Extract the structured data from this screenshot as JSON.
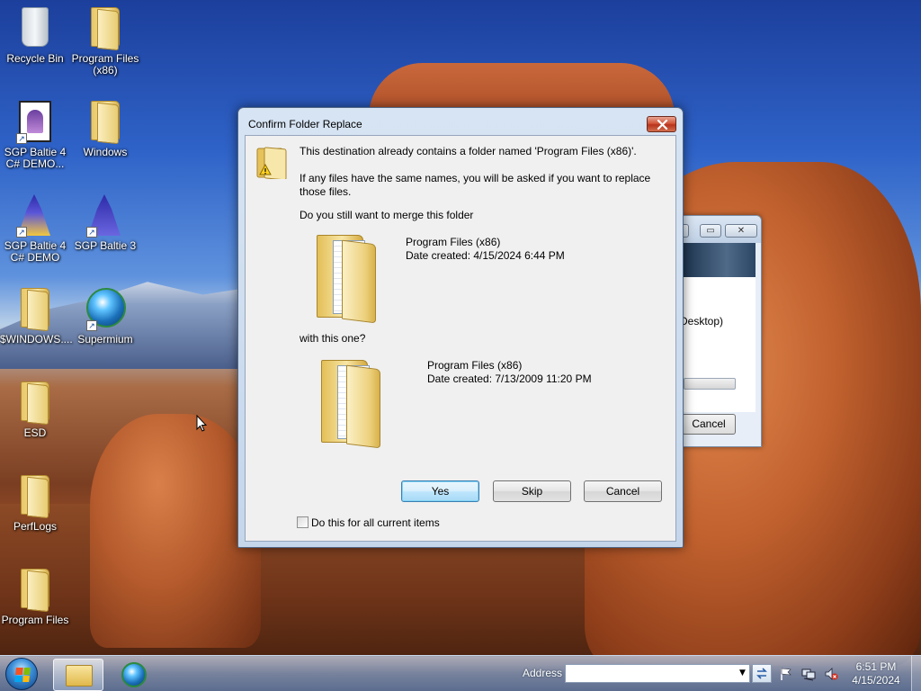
{
  "desktop": {
    "icons": [
      {
        "label": "Recycle Bin"
      },
      {
        "label": "Program Files (x86)"
      },
      {
        "label": "SGP Baltie 4 C# DEMO..."
      },
      {
        "label": "Windows"
      },
      {
        "label": "SGP Baltie 4 C# DEMO"
      },
      {
        "label": "SGP Baltie 3"
      },
      {
        "label": "$WINDOWS...."
      },
      {
        "label": "Supermium"
      },
      {
        "label": "ESD"
      },
      {
        "label": "PerfLogs"
      },
      {
        "label": "Program Files"
      }
    ]
  },
  "background_dialog": {
    "path_fragment": "Desktop)",
    "cancel_label": "Cancel"
  },
  "dialog": {
    "title": "Confirm Folder Replace",
    "message": "This destination already contains a folder named 'Program Files (x86)'.",
    "detail": "If any files have the same names, you will be asked if you want to replace those files.",
    "question": "Do you still want to merge this folder",
    "source": {
      "name": "Program Files (x86)",
      "date": "Date created: 4/15/2024 6:44 PM"
    },
    "with_text": "with this one?",
    "destination": {
      "name": "Program Files (x86)",
      "date": "Date created: 7/13/2009 11:20 PM"
    },
    "buttons": {
      "yes": "Yes",
      "skip": "Skip",
      "cancel": "Cancel"
    },
    "checkbox_label": "Do this for all current items",
    "checkbox_checked": false
  },
  "taskbar": {
    "address_label": "Address",
    "address_value": "",
    "time": "6:51 PM",
    "date": "4/15/2024"
  },
  "colors": {
    "default_button_border": "#3c7fb1",
    "close_button": "#c7432a"
  }
}
